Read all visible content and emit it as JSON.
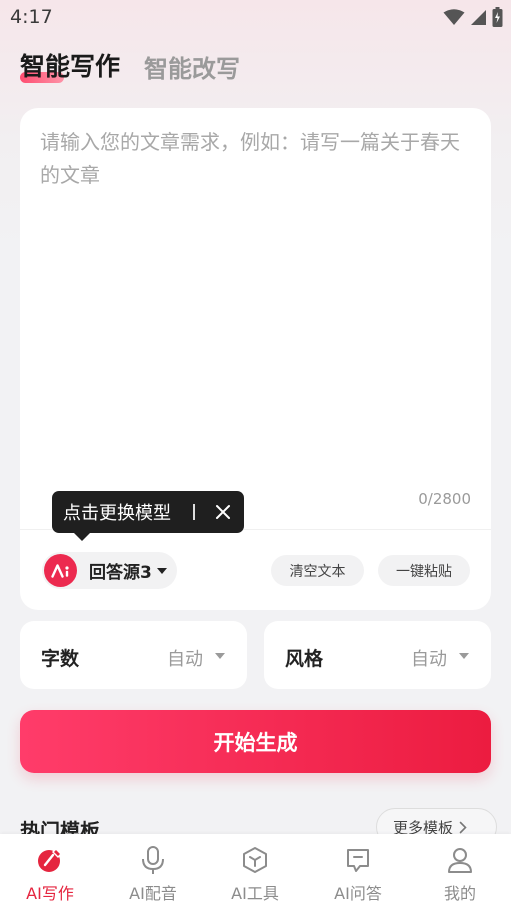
{
  "status_bar": {
    "time": "4:17"
  },
  "tabs": {
    "active": "智能写作",
    "inactive": "智能改写"
  },
  "editor": {
    "placeholder": "请输入您的文章需求，例如：请写一篇关于春天的文章",
    "char_count": "0/2800"
  },
  "tooltip": {
    "text": "点击更换模型"
  },
  "model": {
    "label": "回答源3"
  },
  "actions": {
    "clear": "清空文本",
    "paste": "一键粘贴"
  },
  "options": {
    "words": {
      "label": "字数",
      "value": "自动"
    },
    "style": {
      "label": "风格",
      "value": "自动"
    }
  },
  "generate": {
    "label": "开始生成"
  },
  "templates": {
    "title": "热门模板",
    "more": "更多模板"
  },
  "nav": [
    {
      "label": "AI写作",
      "icon": "pen-icon",
      "active": true
    },
    {
      "label": "AI配音",
      "icon": "microphone-icon",
      "active": false
    },
    {
      "label": "AI工具",
      "icon": "cube-icon",
      "active": false
    },
    {
      "label": "AI问答",
      "icon": "chat-icon",
      "active": false
    },
    {
      "label": "我的",
      "icon": "user-icon",
      "active": false
    }
  ],
  "colors": {
    "accent": "#E5253F",
    "generate_start": "#FF3C6A",
    "generate_end": "#EC1C40"
  }
}
